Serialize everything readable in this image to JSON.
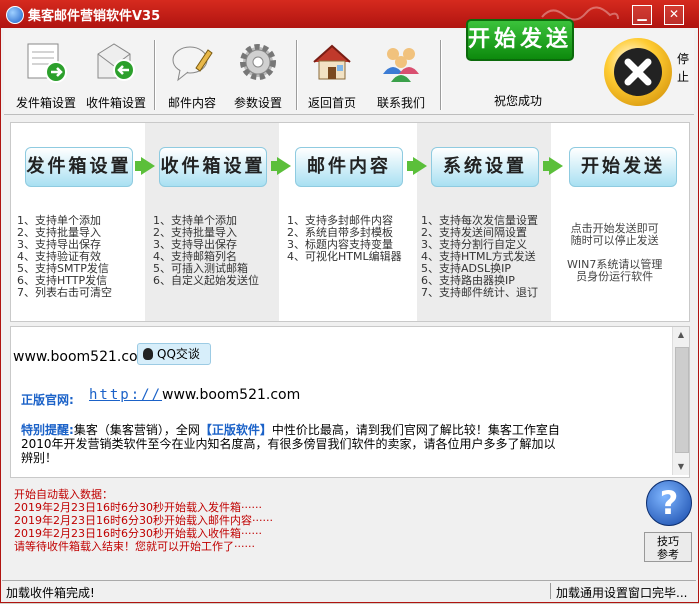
{
  "window": {
    "title": "集客邮件营销软件V35",
    "min": "▁",
    "close": "✕"
  },
  "toolbar": {
    "outbox": "发件箱设置",
    "inbox": "收件箱设置",
    "content": "邮件内容",
    "params": "参数设置",
    "home": "返回首页",
    "contact": "联系我们",
    "start": "开始发送",
    "status": "祝您成功",
    "stop_label": "停止"
  },
  "flow": {
    "steps": [
      "发件箱设置",
      "收件箱设置",
      "邮件内容",
      "系统设置",
      "开始发送"
    ],
    "features": [
      "1、支持单个添加\n2、支持批量导入\n3、支持导出保存\n4、支持验证有效\n5、支持SMTP发信\n6、支持HTTP发信\n7、列表右击可清空",
      "1、支持单个添加\n2、支持批量导入\n3、支持导出保存\n4、支持邮箱列名\n5、可插入测试邮箱\n6、自定义起始发送位",
      "1、支持多封邮件内容\n2、系统自带多封模板\n3、标题内容支持变量\n4、可视化HTML编辑器",
      "1、支持每次发信量设置\n2、支持发送间隔设置\n3、支持分割行自定义\n4、支持HTML方式发送\n5、支持ADSL换IP\n6、支持路由器换IP\n7、支持邮件统计、退订",
      "点击开始发送即可\n随时可以停止发送\n\nWIN7系统请以管理\n员身份运行软件"
    ]
  },
  "info": {
    "site": "www.boom521.com",
    "qq": "QQ交谈",
    "official_label": "正版官网:",
    "official_prefix": "http://",
    "official_site": "www.boom521.com",
    "tip_label": "特别提醒:",
    "tip_a": "集客（集客营销），全网",
    "tip_kw": "【正版软件】",
    "tip_b": "中性价比最高，请到我们官网了解比较！集客工作室自2010年开发营销类软件至今在业内知名度高，有很多傍冒我们软件的卖家，请各位用户多多了解加以辨别！"
  },
  "log": "开始自动载入数据：\n2019年2月23日16时6分30秒开始载入发件箱······\n2019年2月23日16时6分30秒开始载入邮件内容······\n2019年2月23日16时6分30秒开始载入收件箱······\n请等待收件箱载入结束！您就可以开始工作了······",
  "help": {
    "mark": "?",
    "tips": "技巧\n参考"
  },
  "statusbar": {
    "left": "加载收件箱完成!",
    "right": "加载通用设置窗口完毕..."
  },
  "colors": {
    "title_red": "#c41d14",
    "start_green": "#16a016",
    "link_blue": "#1b62c8",
    "log_red": "#c00000"
  }
}
